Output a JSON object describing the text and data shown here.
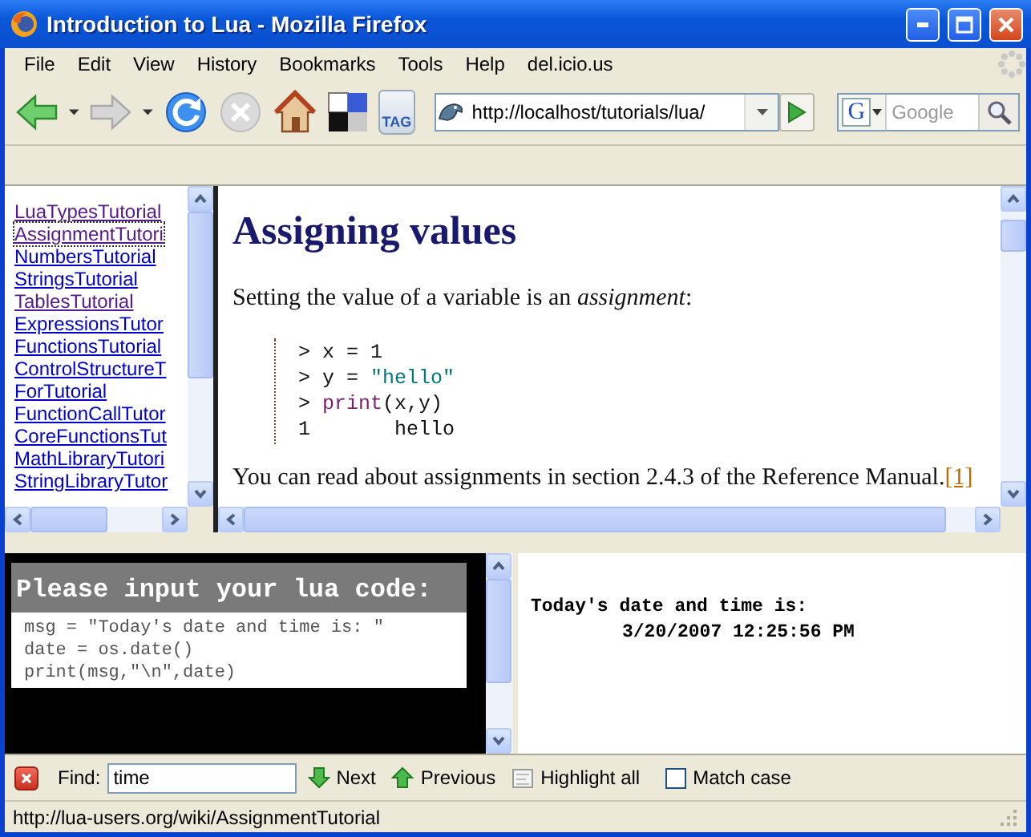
{
  "window": {
    "title": "Introduction to Lua - Mozilla Firefox"
  },
  "menu": [
    {
      "label": "File"
    },
    {
      "label": "Edit"
    },
    {
      "label": "View"
    },
    {
      "label": "History"
    },
    {
      "label": "Bookmarks"
    },
    {
      "label": "Tools"
    },
    {
      "label": "Help"
    },
    {
      "label": "del.icio.us"
    }
  ],
  "toolbar": {
    "tag_label": "TAG",
    "url": "http://localhost/tutorials/lua/",
    "search_engine": "G",
    "search_placeholder": "Google"
  },
  "sidebar": {
    "links": [
      {
        "label": "LuaTypesTutorial",
        "visited": true,
        "focused": false
      },
      {
        "label": "AssignmentTutori",
        "visited": true,
        "focused": true
      },
      {
        "label": "NumbersTutorial",
        "visited": false,
        "focused": false
      },
      {
        "label": "StringsTutorial",
        "visited": false,
        "focused": false
      },
      {
        "label": "TablesTutorial",
        "visited": true,
        "focused": false
      },
      {
        "label": "ExpressionsTutor",
        "visited": false,
        "focused": false
      },
      {
        "label": "FunctionsTutorial",
        "visited": false,
        "focused": false
      },
      {
        "label": "ControlStructureT",
        "visited": false,
        "focused": false
      },
      {
        "label": "ForTutorial",
        "visited": false,
        "focused": false
      },
      {
        "label": "FunctionCallTutor",
        "visited": false,
        "focused": false
      },
      {
        "label": "CoreFunctionsTut",
        "visited": false,
        "focused": false
      },
      {
        "label": "MathLibraryTutori",
        "visited": false,
        "focused": false
      },
      {
        "label": "StringLibraryTutor",
        "visited": false,
        "focused": false
      }
    ]
  },
  "article": {
    "heading": "Assigning values",
    "intro": "Setting the value of a variable is an *assignment*:",
    "code_lines": [
      [
        {
          "kind": "plain",
          "text": "> x = 1"
        }
      ],
      [
        {
          "kind": "plain",
          "text": "> y = "
        },
        {
          "kind": "string",
          "text": "\"hello\""
        }
      ],
      [
        {
          "kind": "plain",
          "text": "> "
        },
        {
          "kind": "keyword",
          "text": "print"
        },
        {
          "kind": "plain",
          "text": "(x,y)"
        }
      ],
      [
        {
          "kind": "plain",
          "text": "1       hello"
        }
      ]
    ],
    "outro": "You can read about assignments in section 2.4.3 of the Reference Manual.",
    "footnote_link": "[1]"
  },
  "editor": {
    "heading": "Please input your lua code:",
    "code_lines": [
      "msg = \"Today's date and time is: \"",
      "date = os.date()",
      "print(msg,\"\\n\",date)"
    ]
  },
  "output": {
    "lines": [
      "Today's date and time is:",
      "3/20/2007 12:25:56 PM"
    ]
  },
  "find_bar": {
    "label": "Find:",
    "value": "time",
    "next": "Next",
    "previous": "Previous",
    "highlight_all": "Highlight all",
    "match_case": {
      "label": "Match case",
      "checked": false
    }
  },
  "status_bar": {
    "text": "http://lua-users.org/wiki/AssignmentTutorial"
  }
}
